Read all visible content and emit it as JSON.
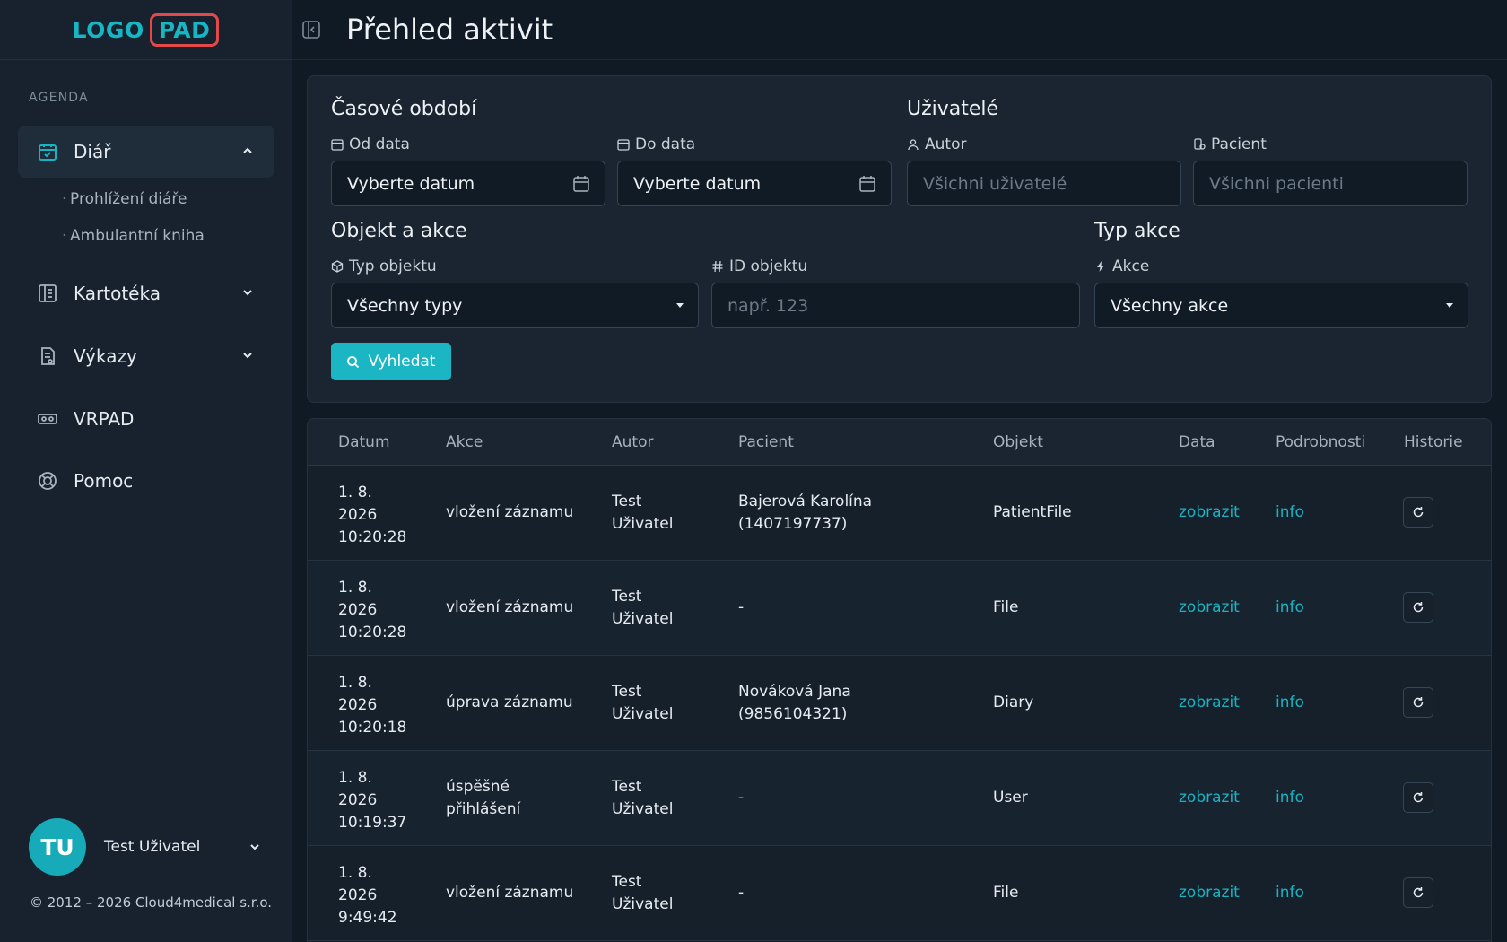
{
  "logo": {
    "left": "LOGO",
    "right": "PAD"
  },
  "sidebar": {
    "section_label": "AGENDA",
    "items": [
      {
        "label": "Diář",
        "icon": "calendar-check-icon",
        "expanded": true
      },
      {
        "label": "Kartotéka",
        "icon": "file-cabinet-icon"
      },
      {
        "label": "Výkazy",
        "icon": "report-icon"
      },
      {
        "label": "VRPAD",
        "icon": "vr-headset-icon"
      },
      {
        "label": "Pomoc",
        "icon": "lifebuoy-icon"
      }
    ],
    "sub_items": [
      "Prohlížení diáře",
      "Ambulantní kniha"
    ],
    "user": {
      "initials": "TU",
      "name": "Test Uživatel"
    },
    "copyright": "© 2012 – 2026 Cloud4medical s.r.o."
  },
  "header": {
    "title": "Přehled aktivit"
  },
  "filters": {
    "period": {
      "title": "Časové období",
      "from_label": "Od data",
      "from_value": "Vyberte datum",
      "to_label": "Do data",
      "to_value": "Vyberte datum"
    },
    "users": {
      "title": "Uživatelé",
      "author_label": "Autor",
      "author_placeholder": "Všichni uživatelé",
      "patient_label": "Pacient",
      "patient_placeholder": "Všichni pacienti"
    },
    "object": {
      "title": "Objekt a akce",
      "type_label": "Typ objektu",
      "type_value": "Všechny typy",
      "id_label": "ID objektu",
      "id_placeholder": "např. 123"
    },
    "action_type": {
      "title": "Typ akce",
      "action_label": "Akce",
      "action_value": "Všechny akce"
    },
    "search_label": "Vyhledat"
  },
  "table": {
    "headers": [
      "Datum",
      "Akce",
      "Autor",
      "Pacient",
      "Objekt",
      "Data",
      "Podrobnosti",
      "Historie"
    ],
    "rows": [
      {
        "date1": "1. 8.",
        "date2": "2026",
        "time": "10:20:28",
        "action1": "vložení záznamu",
        "action2": "",
        "author1": "Test",
        "author2": "Uživatel",
        "patient1": "Bajerová Karolína",
        "patient2": "(1407197737)",
        "object": "PatientFile",
        "data": "zobrazit",
        "details": "info"
      },
      {
        "date1": "1. 8.",
        "date2": "2026",
        "time": "10:20:28",
        "action1": "vložení záznamu",
        "action2": "",
        "author1": "Test",
        "author2": "Uživatel",
        "patient1": "-",
        "patient2": "",
        "object": "File",
        "data": "zobrazit",
        "details": "info"
      },
      {
        "date1": "1. 8.",
        "date2": "2026",
        "time": "10:20:18",
        "action1": "úprava záznamu",
        "action2": "",
        "author1": "Test",
        "author2": "Uživatel",
        "patient1": "Nováková Jana",
        "patient2": "(9856104321)",
        "object": "Diary",
        "data": "zobrazit",
        "details": "info"
      },
      {
        "date1": "1. 8.",
        "date2": "2026",
        "time": "10:19:37",
        "action1": "úspěšné",
        "action2": "přihlášení",
        "author1": "Test",
        "author2": "Uživatel",
        "patient1": "-",
        "patient2": "",
        "object": "User",
        "data": "zobrazit",
        "details": "info"
      },
      {
        "date1": "1. 8.",
        "date2": "2026",
        "time": "9:49:42",
        "action1": "vložení záznamu",
        "action2": "",
        "author1": "Test",
        "author2": "Uživatel",
        "patient1": "-",
        "patient2": "",
        "object": "File",
        "data": "zobrazit",
        "details": "info"
      }
    ]
  },
  "colors": {
    "accent": "#1ab6c4",
    "background": "#101a24",
    "logo_border": "#e24a4a"
  }
}
